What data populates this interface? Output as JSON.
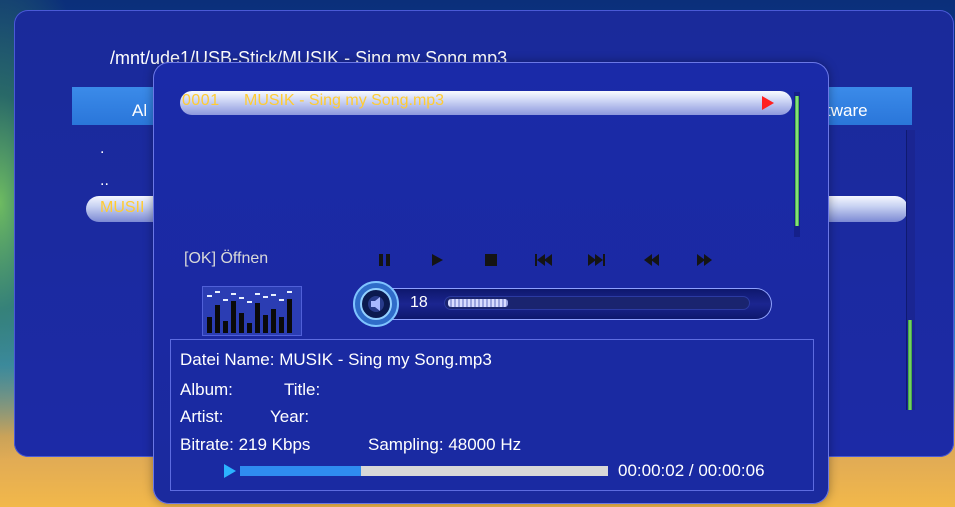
{
  "background_window": {
    "path": "/mnt/ude1/USB-Stick/MUSIK - Sing my Song.mp3",
    "header_left": "Al",
    "header_right": "tware",
    "items": [
      ".",
      "..",
      "MUSII"
    ]
  },
  "player": {
    "playlist": [
      {
        "number": "0001",
        "title": "MUSIK - Sing my Song.mp3"
      }
    ],
    "ok_open_label": "[OK] Öffnen",
    "controls": [
      "pause-icon",
      "play-icon",
      "stop-icon",
      "previous-icon",
      "next-icon",
      "rewind-icon",
      "fast-forward-icon"
    ],
    "volume": {
      "value": "18",
      "level": 0.2
    },
    "info": {
      "file_name": "Datei Name: MUSIK - Sing my Song.mp3",
      "album_label": "Album:",
      "title_label": "Title:",
      "artist_label": "Artist:",
      "year_label": "Year:",
      "bitrate": "Bitrate: 219 Kbps",
      "sampling": "Sampling: 48000 Hz"
    },
    "progress": {
      "fraction": 0.33,
      "time": "00:00:02 / 00:00:06"
    }
  },
  "colors": {
    "accent_yellow": "#ffcc33",
    "progress_blue": "#2f8cf0",
    "indicator_red": "#ff1f1f"
  }
}
